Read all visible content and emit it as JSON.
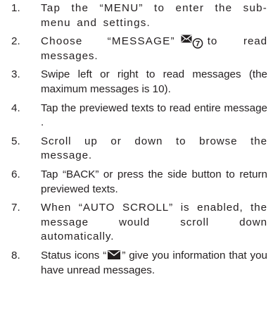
{
  "steps": [
    {
      "num": "1.",
      "text": "Tap the “MENU” to enter the sub-menu and settings."
    },
    {
      "num": "2.",
      "before": "Choose “MESSAGE”",
      "icon_name": "message-envelope-icon",
      "icon_digit": "7",
      "after": "to read messages."
    },
    {
      "num": "3.",
      "text": "Swipe left or right to read messages (the maximum messages is 10)."
    },
    {
      "num": "4.",
      "text": "Tap the previewed texts to read entire message ."
    },
    {
      "num": "5.",
      "text": "Scroll up or down to browse the message."
    },
    {
      "num": "6.",
      "text": "Tap “BACK” or press the side button to return previewed texts."
    },
    {
      "num": "7.",
      "text": "When “AUTO SCROLL” is enabled, the message would scroll down automatically."
    },
    {
      "num": "8.",
      "before": "Status icons “",
      "icon_name": "unread-message-envelope-icon",
      "after": "” give you information that you have unread messages."
    }
  ]
}
